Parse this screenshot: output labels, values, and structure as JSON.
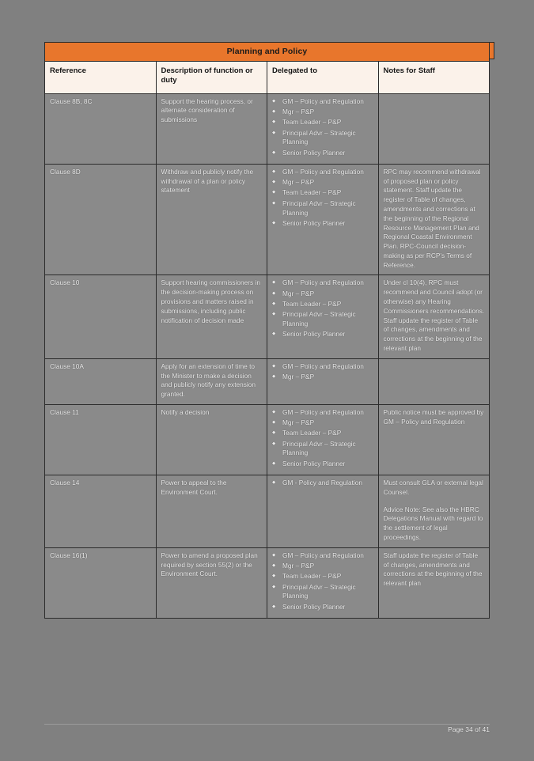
{
  "document": {
    "table_title": "Planning and Policy",
    "footer": "Page 34 of 41"
  },
  "table": {
    "columns": [
      "Reference",
      "Description of function or duty",
      "Delegated to",
      "Notes for Staff"
    ],
    "rows": [
      {
        "reference": "Clause 8B, 8C",
        "description": "Support the hearing process, or alternate consideration of submissions",
        "delegated_to": [
          "GM – Policy and Regulation",
          "Mgr – P&P",
          "Team Leader – P&P",
          "Principal Advr – Strategic Planning",
          "Senior Policy Planner"
        ],
        "notes": []
      },
      {
        "reference": "Clause 8D",
        "description": "Withdraw and publicly notify the withdrawal of a plan or policy statement",
        "delegated_to": [
          "GM – Policy and Regulation",
          "Mgr – P&P",
          "Team Leader – P&P",
          "Principal Advr – Strategic Planning",
          "Senior Policy Planner"
        ],
        "notes": [
          "RPC may recommend withdrawal of proposed plan or policy statement. Staff update the register of Table of changes, amendments and corrections at the beginning of the Regional Resource Management Plan and Regional Coastal Environment Plan. RPC-Council decision-making as per RCP's Terms of Reference."
        ]
      },
      {
        "reference": "Clause 10",
        "description": "Support hearing commissioners in the decision-making process on provisions and matters raised in submissions, including public notification of decision made",
        "delegated_to": [
          "GM – Policy and Regulation",
          "Mgr – P&P",
          "Team Leader – P&P",
          "Principal Advr – Strategic Planning",
          "Senior Policy Planner"
        ],
        "notes": [
          "Under cl 10(4), RPC must recommend and Council adopt (or otherwise) any Hearing Commissioners recommendations. Staff update the register of Table of changes, amendments and corrections at the beginning of the relevant plan"
        ]
      },
      {
        "reference": "Clause 10A",
        "description": "Apply for an extension of time to the Minister to make a decision and publicly notify any extension granted.",
        "delegated_to": [
          "GM – Policy and Regulation",
          "Mgr – P&P"
        ],
        "notes": []
      },
      {
        "reference": "Clause 11",
        "description": "Notify a decision",
        "delegated_to": [
          "GM – Policy and Regulation",
          "Mgr – P&P",
          "Team Leader – P&P",
          "Principal Advr – Strategic Planning",
          "Senior Policy Planner"
        ],
        "notes": [
          "Public notice must be approved by GM – Policy and Regulation"
        ]
      },
      {
        "reference": "Clause 14",
        "description": "Power to appeal to the Environment Court.",
        "delegated_to": [
          "GM - Policy and Regulation"
        ],
        "notes": [
          "Must consult GLA or external legal Counsel.",
          "Advice Note: See also the HBRC Delegations Manual with regard to the settlement of legal proceedings."
        ]
      },
      {
        "reference": "Clause 16(1)",
        "description": "Power to amend a proposed plan required by section 55(2) or the Environment Court.",
        "delegated_to": [
          "GM – Policy and Regulation",
          "Mgr – P&P",
          "Team Leader – P&P",
          "Principal Advr – Strategic Planning",
          "Senior Policy Planner"
        ],
        "notes": [
          "Staff update the register of Table of changes, amendments and corrections at the beginning of the relevant plan"
        ]
      }
    ]
  },
  "colors": {
    "title_bar": "#E8762C",
    "column_header_bg": "#FBF2EA",
    "cell_bg": "#8A8A8A",
    "page_bg": "#808080"
  }
}
